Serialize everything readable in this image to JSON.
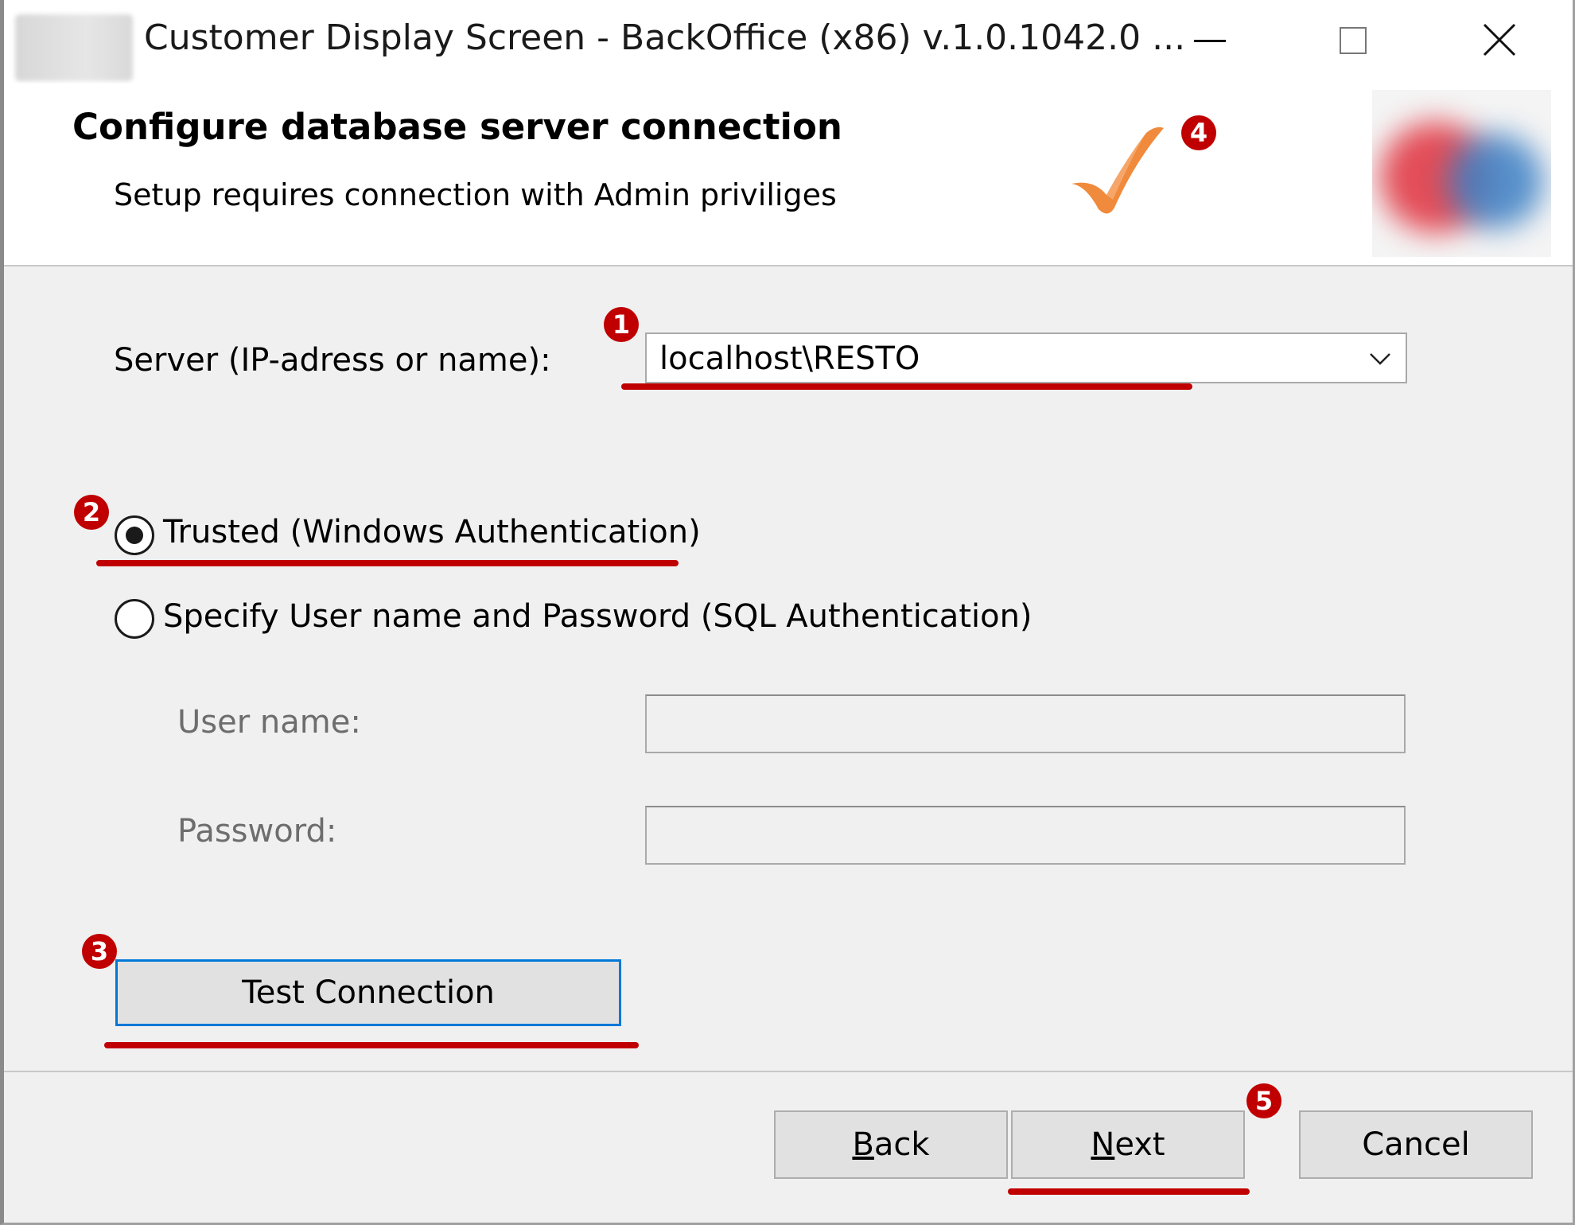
{
  "window": {
    "title": "Customer Display Screen - BackOffice (x86) v.1.0.1042.0 ...",
    "minimize_icon": "minimize-icon",
    "maximize_icon": "maximize-icon",
    "close_icon": "close-icon"
  },
  "header": {
    "title": "Configure database server connection",
    "subtitle": "Setup requires connection with Admin priviliges",
    "status_icon": "checkmark-icon",
    "status_color": "#f08a3c"
  },
  "server": {
    "label": "Server (IP-adress or name):",
    "value": "localhost\\RESTO"
  },
  "auth": {
    "trusted_label": "Trusted (Windows Authentication)",
    "trusted_selected": true,
    "sql_label": "Specify User name and Password (SQL Authentication)",
    "sql_selected": false
  },
  "credentials": {
    "username_label": "User name:",
    "username_value": "",
    "password_label": "Password:",
    "password_value": ""
  },
  "buttons": {
    "test_connection": "Test Connection",
    "back": "Back",
    "back_mnemonic": "B",
    "back_rest": "ack",
    "next": "Next",
    "next_mnemonic": "N",
    "next_rest": "ext",
    "cancel": "Cancel"
  },
  "annotations": {
    "badge_1": "1",
    "badge_2": "2",
    "badge_3": "3",
    "badge_4": "4",
    "badge_5": "5",
    "color": "#c00000"
  },
  "colors": {
    "focus": "#0078d7",
    "window_bg": "#f0f0f0"
  }
}
